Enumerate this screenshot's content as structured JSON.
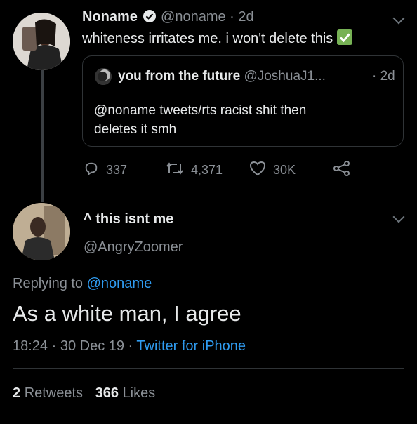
{
  "tweet1": {
    "name": "Noname",
    "handle": "@noname",
    "time": "· 2d",
    "text": "whiteness irritates me. i won't delete this",
    "check_emoji": "✅",
    "quote": {
      "name": "you from the future",
      "handle": "@JoshuaJ1...",
      "time": "· 2d",
      "text_line1": "@noname tweets/rts racist shit then",
      "text_line2": "deletes it smh"
    },
    "actions": {
      "replies": "337",
      "retweets": "4,371",
      "likes": "30K"
    }
  },
  "tweet2": {
    "name": "^ this isnt me",
    "handle": "@AngryZoomer",
    "replying_prefix": "Replying to",
    "replying_handle": "@noname",
    "text": "As a white man, I agree",
    "timestamp": "18:24 · 30 Dec 19 ·",
    "source": "Twitter for iPhone",
    "retweets_count": "2",
    "retweets_label": "Retweets",
    "likes_count": "366",
    "likes_label": "Likes"
  },
  "colors": {
    "background": "#000000",
    "link": "#2f9bf0",
    "verified": "#e7e9ea"
  }
}
